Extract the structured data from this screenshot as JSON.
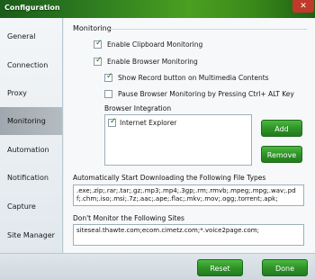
{
  "window": {
    "title": "Configuration",
    "close_glyph": "✕"
  },
  "sidebar": {
    "items": [
      {
        "label": "General"
      },
      {
        "label": "Connection"
      },
      {
        "label": "Proxy"
      },
      {
        "label": "Monitoring",
        "active": true
      },
      {
        "label": "Automation"
      },
      {
        "label": "Notification"
      },
      {
        "label": "Capture"
      },
      {
        "label": "Site Manager"
      }
    ]
  },
  "monitoring": {
    "section_title": "Monitoring",
    "options": [
      {
        "label": "Enable Clipboard Monitoring",
        "checked": true
      },
      {
        "label": "Enable Browser Monitoring",
        "checked": true
      },
      {
        "label": "Show Record button on Multimedia Contents",
        "checked": true
      },
      {
        "label": "Pause Browser Monitoring by Pressing Ctrl+ ALT Key",
        "checked": false
      }
    ],
    "browser_integration": {
      "heading": "Browser Integration",
      "browsers": [
        {
          "label": "Internet Explorer",
          "checked": true
        }
      ],
      "add_label": "Add",
      "remove_label": "Remove"
    },
    "auto_download": {
      "heading": "Automatically Start Downloading the Following File Types",
      "value": ".exe;.zip;.rar;.tar;.gz;.mp3;.mp4;.3gp;.rm;.rmvb;.mpeg;.mpg;.wav;.pdf;.chm;.iso;.msi;.7z;.aac;.ape;.flac;.mkv;.mov;.ogg;.torrent;.apk;"
    },
    "exclude_sites": {
      "heading": "Don't Monitor the Following Sites",
      "value": "siteseal.thawte.com;ecom.cimetz.com;*.voice2page.com;"
    }
  },
  "footer": {
    "reset_label": "Reset",
    "done_label": "Done"
  },
  "colors": {
    "accent_green": "#2f9428",
    "title_bar": "#2e7d20",
    "active_nav": "#a8b0b5"
  }
}
